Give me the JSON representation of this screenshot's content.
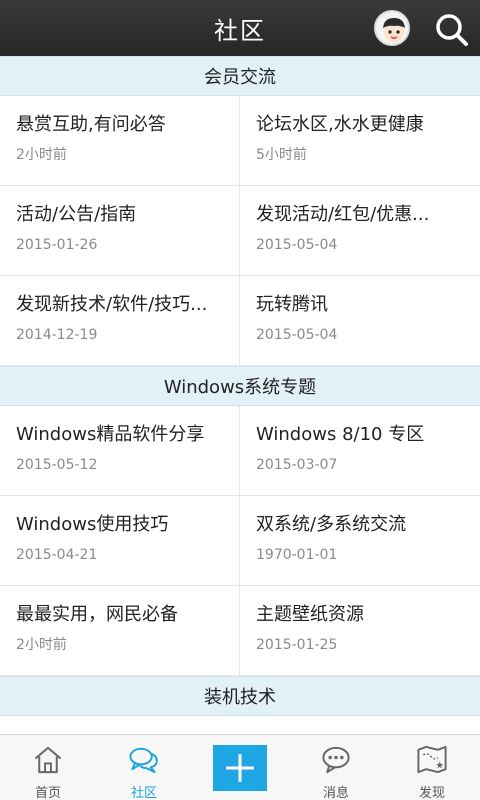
{
  "header": {
    "title": "社区"
  },
  "sections": [
    {
      "title": "会员交流",
      "items": [
        {
          "name": "悬赏互助,有问必答",
          "time": "2小时前"
        },
        {
          "name": "论坛水区,水水更健康",
          "time": "5小时前"
        },
        {
          "name": "活动/公告/指南",
          "time": "2015-01-26"
        },
        {
          "name": "发现活动/红包/优惠...",
          "time": "2015-05-04"
        },
        {
          "name": "发现新技术/软件/技巧...",
          "time": "2014-12-19"
        },
        {
          "name": "玩转腾讯",
          "time": "2015-05-04"
        }
      ]
    },
    {
      "title": "Windows系统专题",
      "items": [
        {
          "name": "Windows精品软件分享",
          "time": "2015-05-12"
        },
        {
          "name": "Windows 8/10 专区",
          "time": "2015-03-07"
        },
        {
          "name": "Windows使用技巧",
          "time": "2015-04-21"
        },
        {
          "name": "双系统/多系统交流",
          "time": "1970-01-01"
        },
        {
          "name": "最最实用，网民必备",
          "time": "2小时前"
        },
        {
          "name": "主题壁纸资源",
          "time": "2015-01-25"
        }
      ]
    },
    {
      "title": "装机技术",
      "items": []
    }
  ],
  "bottom_nav": {
    "home_label": "首页",
    "community_label": "社区",
    "messages_label": "消息",
    "discover_label": "发现",
    "active_color": "#1aa3de"
  }
}
